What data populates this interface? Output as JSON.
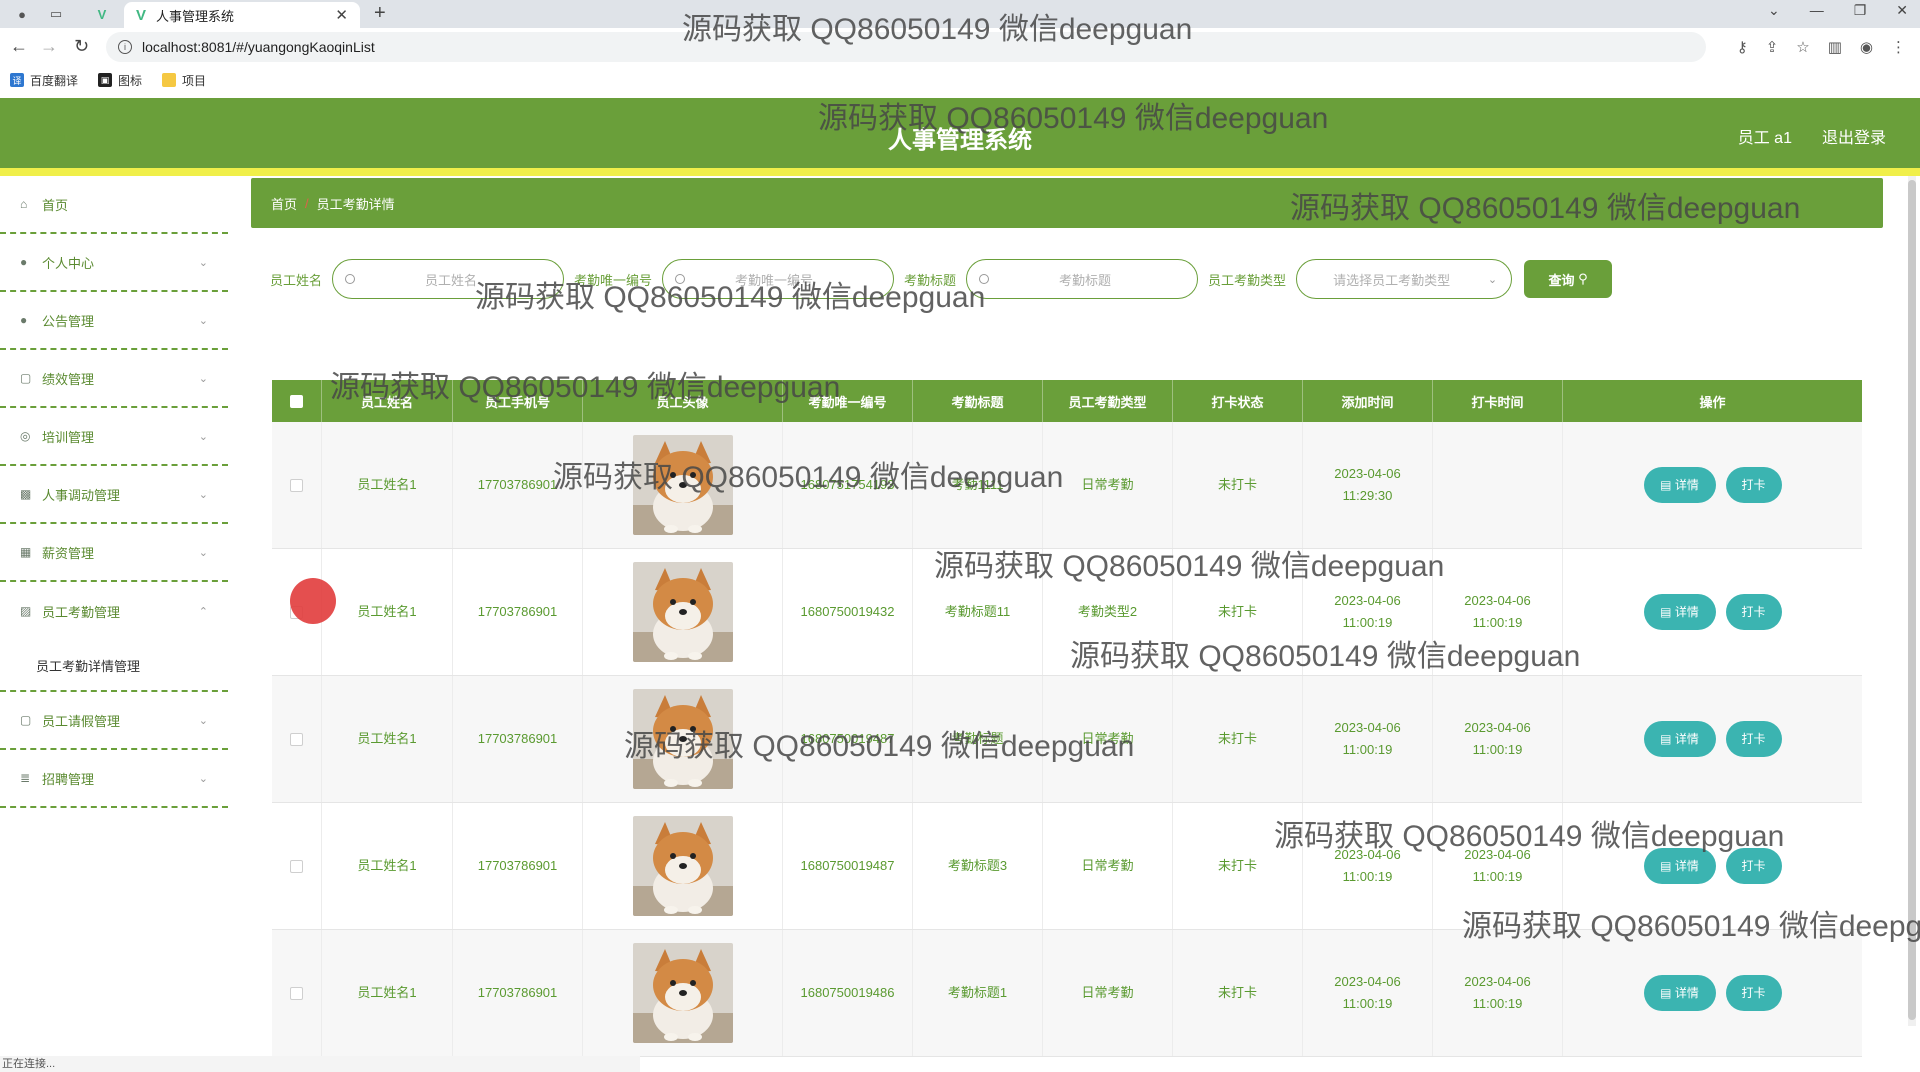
{
  "browser": {
    "tab_title": "人事管理系统",
    "url": "localhost:8081/#/yuangongKaoqinList",
    "bookmarks": [
      "百度翻译",
      "图标",
      "项目"
    ]
  },
  "header": {
    "title": "人事管理系统",
    "user": "员工 a1",
    "logout": "退出登录"
  },
  "sidebar": {
    "items": [
      {
        "label": "首页",
        "icon": "home-icon"
      },
      {
        "label": "个人中心",
        "icon": "user-icon"
      },
      {
        "label": "公告管理",
        "icon": "user-icon"
      },
      {
        "label": "绩效管理",
        "icon": "chat-icon"
      },
      {
        "label": "培训管理",
        "icon": "compass-icon"
      },
      {
        "label": "人事调动管理",
        "icon": "trash-icon"
      },
      {
        "label": "薪资管理",
        "icon": "grid-icon"
      },
      {
        "label": "员工考勤管理",
        "icon": "chart-icon"
      },
      {
        "label": "员工请假管理",
        "icon": "chat-icon"
      },
      {
        "label": "招聘管理",
        "icon": "stack-icon"
      }
    ],
    "sub_item": "员工考勤详情管理"
  },
  "breadcrumb": {
    "home": "首页",
    "sep": "/",
    "current": "员工考勤详情"
  },
  "search": {
    "name_label": "员工姓名",
    "name_placeholder": "员工姓名",
    "code_label": "考勤唯一编号",
    "code_placeholder": "考勤唯一编号",
    "title_label": "考勤标题",
    "title_placeholder": "考勤标题",
    "type_label": "员工考勤类型",
    "type_placeholder": "请选择员工考勤类型",
    "query_button": "查询"
  },
  "table": {
    "headers": [
      "员工姓名",
      "员工手机号",
      "员工头像",
      "考勤唯一编号",
      "考勤标题",
      "员工考勤类型",
      "打卡状态",
      "添加时间",
      "打卡时间",
      "操作"
    ],
    "rows": [
      {
        "name": "员工姓名1",
        "phone": "17703786901",
        "code": "1680751754193",
        "title": "考勤1111",
        "type": "日常考勤",
        "status": "未打卡",
        "added": "2023-04-06 11:29:30",
        "punch": ""
      },
      {
        "name": "员工姓名1",
        "phone": "17703786901",
        "code": "1680750019432",
        "title": "考勤标题11",
        "type": "考勤类型2",
        "status": "未打卡",
        "added": "2023-04-06 11:00:19",
        "punch": "2023-04-06 11:00:19"
      },
      {
        "name": "员工姓名1",
        "phone": "17703786901",
        "code": "1680750019487",
        "title": "考勤标题",
        "type": "日常考勤",
        "status": "未打卡",
        "added": "2023-04-06 11:00:19",
        "punch": "2023-04-06 11:00:19"
      },
      {
        "name": "员工姓名1",
        "phone": "17703786901",
        "code": "1680750019487",
        "title": "考勤标题3",
        "type": "日常考勤",
        "status": "未打卡",
        "added": "2023-04-06 11:00:19",
        "punch": "2023-04-06 11:00:19"
      },
      {
        "name": "员工姓名1",
        "phone": "17703786901",
        "code": "1680750019486",
        "title": "考勤标题1",
        "type": "日常考勤",
        "status": "未打卡",
        "added": "2023-04-06 11:00:19",
        "punch": "2023-04-06 11:00:19"
      }
    ],
    "detail_button": "详情",
    "punch_button": "打卡"
  },
  "status_bar": "正在连接...",
  "watermark": "源码获取 QQ86050149 微信deepguan",
  "colors": {
    "accent": "#6a9f3a",
    "header_strip": "#f0ef4a",
    "button": "#3bb4b1"
  }
}
